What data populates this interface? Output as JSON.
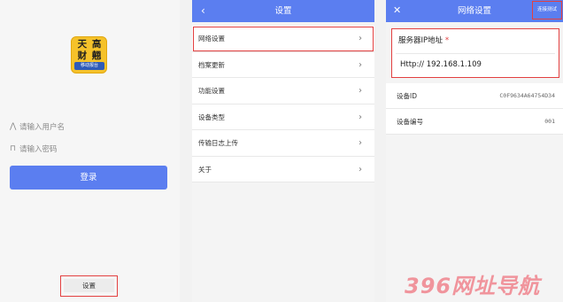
{
  "login": {
    "logo_line1": "天 高",
    "logo_line2": "财 翹",
    "logo_sub": "移动报台",
    "username_placeholder": "请输入用户名",
    "password_placeholder": "请输入密码",
    "login_label": "登录",
    "settings_label": "设置"
  },
  "settings": {
    "title": "设置",
    "items": [
      {
        "label": "网络设置"
      },
      {
        "label": "档案更新"
      },
      {
        "label": "功能设置"
      },
      {
        "label": "设备类型"
      },
      {
        "label": "传输日志上传"
      },
      {
        "label": "关于"
      }
    ]
  },
  "network": {
    "title": "网络设置",
    "test_label": "连接测试",
    "server_label": "服务器IP地址",
    "server_required": "*",
    "server_value": "Http:// 192.168.1.109",
    "device_id_label": "设备ID",
    "device_id_value": "C0F9634A64754D34",
    "device_no_label": "设备编号",
    "device_no_value": "001"
  },
  "watermark": "396网址导航",
  "colors": {
    "accent": "#5b7ef0",
    "highlight": "#e34040",
    "logo": "#f5c22a"
  }
}
